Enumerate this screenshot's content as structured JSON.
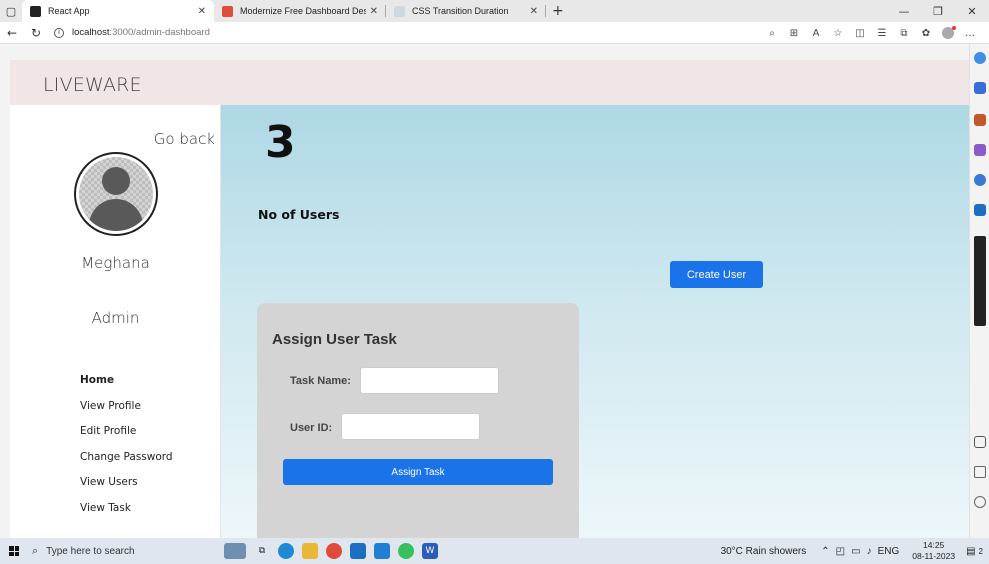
{
  "browser": {
    "tabs": [
      {
        "label": "React App",
        "favicon_color": "#222222",
        "active": true
      },
      {
        "label": "Modernize Free Dashboard Desi",
        "favicon_color": "#e24c3a",
        "active": false
      },
      {
        "label": "CSS Transition Duration",
        "favicon_color": "#cfd8dc",
        "active": false
      }
    ],
    "url_host": "localhost",
    "url_path": ":3000/admin-dashboard"
  },
  "app": {
    "brand": "LIVEWARE",
    "go_back": "Go back",
    "user_name": "Meghana",
    "user_role": "Admin",
    "menu": [
      {
        "label": "Home",
        "active": true
      },
      {
        "label": "View Profile",
        "active": false
      },
      {
        "label": "Edit Profile",
        "active": false
      },
      {
        "label": "Change Password",
        "active": false
      },
      {
        "label": "View Users",
        "active": false
      },
      {
        "label": "View Task",
        "active": false
      }
    ],
    "user_count": "3",
    "user_count_label": "No of Users",
    "create_user_label": "Create User",
    "assign_card": {
      "title": "Assign User Task",
      "task_name_label": "Task Name:",
      "task_name_value": "",
      "user_id_label": "User ID:",
      "user_id_value": "",
      "submit_label": "Assign Task"
    },
    "accent_color": "#1a73e8"
  },
  "taskbar": {
    "search_placeholder": "Type here to search",
    "weather": "30°C  Rain showers",
    "language": "ENG",
    "time": "14:25",
    "date": "08-11-2023",
    "notification_count": "2"
  }
}
